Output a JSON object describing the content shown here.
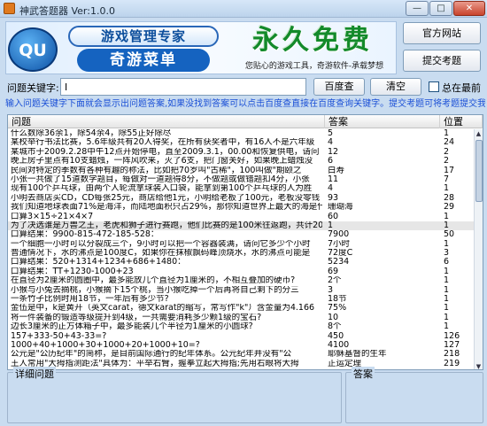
{
  "window": {
    "title": "神武答题器 Ver:1.0.0",
    "min_symbol": "—",
    "max_symbol": "□",
    "close_symbol": "✕"
  },
  "banner": {
    "logo_text": "QU",
    "brand_main": "游戏管理专家",
    "brand_sub": "奇游菜单",
    "slogan": "永久免费",
    "tagline": "您贴心的游戏工具，奇游软件-承载梦想"
  },
  "buttons": {
    "official_site": "官方网站",
    "submit_question": "提交考题",
    "search_baidu": "百度查",
    "clear": "清空"
  },
  "search": {
    "label": "问题关键字:",
    "value": "I",
    "always_on_top_label": "总在最前"
  },
  "hint": "输入问题关键字下面就会显示出问题答案,如果没找到答案可以点击百度查直接在百度查询关键字。提交考题可将考题提交我们",
  "table": {
    "headers": [
      "问题",
      "答案",
      "位置"
    ],
    "rows": [
      {
        "q": "什么数除36余1，除54余4，除55正好除尽",
        "a": "5",
        "p": "1"
      },
      {
        "q": "某校举行书法比赛，5.6年级共有20人得奖，在所有获奖者中，有16人不是六年级",
        "a": "4",
        "p": "24"
      },
      {
        "q": "某城市于2009.2.28中午12点开始停电，直至2009.3.1，00.00和恢复供电，请问",
        "a": "12",
        "p": "2"
      },
      {
        "q": "晚上房子里点有10支蜡烛，一阵风吹来，灭了6支，把门窗关好，如果晚上蜡烛没",
        "a": "6",
        "p": "2"
      },
      {
        "q": "民间对特定的季数有各种有趣的称法，比如把70岁叫\"古稀\"，100叫做\"期颐之",
        "a": "白寿",
        "p": "17"
      },
      {
        "q": "小张一共做了15道数学题目，每做对一道题得8分，不做题或做错题扣4分，小张",
        "a": "11",
        "p": "7"
      },
      {
        "q": "现有100个乒乓球，由两个人轮流拿球装入口袋，能拿到第100个乒乓球的人为胜",
        "a": "4",
        "p": "1"
      },
      {
        "q": "小明去商店买CD，CD每张25元，商店给他1元，小明给老板了100元，老板没零钱",
        "a": "93",
        "p": "28"
      },
      {
        "q": "我们知道地球表面71%是海洋，而陆地面积只占29%，那你知道世界上最大的海是什",
        "a": "珊瑚海",
        "p": "29"
      },
      {
        "q": "口算3×15÷21×4×7",
        "a": "60",
        "p": "1"
      },
      {
        "q": "为了决选谁是万兽之王，老虎和狮子进行赛跑，他们比赛的是100米往返跑，共计200",
        "a": "1",
        "p": "1"
      },
      {
        "q": "口算结果：9900-815-472-185-528：",
        "a": "7900",
        "p": "50"
      },
      {
        "q": "一个细胞一小时可以分裂成三个，9小时可以把一个容器装满，请问它多少个小时",
        "a": "7小时",
        "p": "1"
      },
      {
        "q": "普通情况下，水的沸点是100度C，如果你在抹椒飘码峰顶烧水，水的沸点可能是",
        "a": "72度C",
        "p": "3"
      },
      {
        "q": "口算结果：520+1314+1234+686+1480：",
        "a": "5234",
        "p": "6"
      },
      {
        "q": "口算结果：TT+1230-1000+23",
        "a": "69",
        "p": "1"
      },
      {
        "q": "在直径为2厘米的圆圈中，最多能放几个直径为1厘米的，不相互叠加的硬币?",
        "a": "2个",
        "p": "1"
      },
      {
        "q": "小猴与小兔去摘桃，小猴摘下15个桃，当小猴吃掉一个后再将自己剩下的分三",
        "a": "3",
        "p": "1"
      },
      {
        "q": "一条竹子比例时用18节，一年后有多少节?",
        "a": "18节",
        "p": "1"
      },
      {
        "q": "金伍是中，k是黄开（英文carat，德文karat的缩写，常写作\"k\"）含金量为4.166",
        "a": "75%",
        "p": "1"
      },
      {
        "q": "将一件装备的锻造等级提升到4级，一共需要消耗多少颗1级的宝石?",
        "a": "10",
        "p": "1"
      },
      {
        "q": "边长3厘米的正方体箱子中，最多能装几个半径为1厘米的小圆球?",
        "a": "8个",
        "p": "1"
      },
      {
        "q": "157+333-50+43-33=?",
        "a": "450",
        "p": "126"
      },
      {
        "q": "1000+40+1000+30+1000+20+1000+10=?",
        "a": "4100",
        "p": "127"
      },
      {
        "q": "公元是\"公历纪年\"的简称，是目前国际通行的纪年体系。公元纪年并没有\"公",
        "a": "耶稣基督的生年",
        "p": "218"
      },
      {
        "q": "王人常用\"大拇指测距法\"具体为：平举右臂，握拳立起大拇指;先用右眼将大拇",
        "a": "正运定理",
        "p": "219"
      }
    ]
  },
  "detail": {
    "question_label": "详细问题",
    "answer_label": "答案"
  }
}
